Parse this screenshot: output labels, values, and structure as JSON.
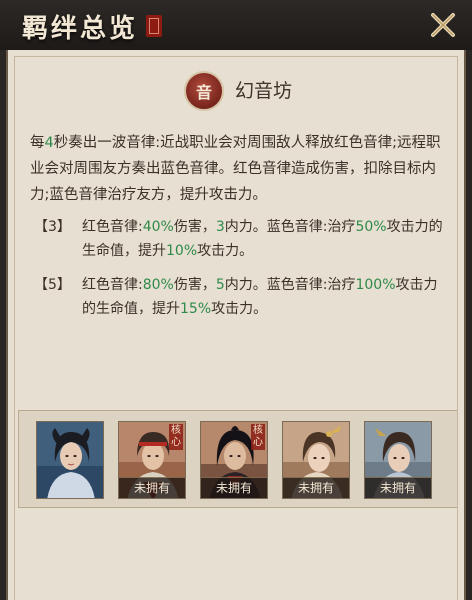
{
  "header": {
    "title": "羁绊总览"
  },
  "faction": {
    "badge_text": "音",
    "name": "幻音坊",
    "description_parts": [
      "每",
      "4",
      "秒奏出一波音律:近战职业会对周围敌人释放红色音律;远程职业会对周围友方奏出蓝色音律。红色音律造成伤害，扣除目标内力;蓝色音律治疗友方，提升攻击力。"
    ]
  },
  "tiers": [
    {
      "label": "【3】",
      "parts": [
        "红色音律:",
        "40%",
        "伤害，",
        "3",
        "内力。蓝色音律:治疗",
        "50%",
        "攻击力的生命值，提升",
        "10%",
        "攻击力。"
      ]
    },
    {
      "label": "【5】",
      "parts": [
        "红色音律:",
        "80%",
        "伤害，",
        "5",
        "内力。蓝色音律:治疗",
        "100%",
        "攻击力的生命值，提升",
        "15%",
        "攻击力。"
      ]
    }
  ],
  "heroes": [
    {
      "status": "",
      "core": "",
      "portrait": "female-dark-hair-icon"
    },
    {
      "status": "未拥有",
      "core": "核心",
      "portrait": "male-red-band-icon"
    },
    {
      "status": "未拥有",
      "core": "核心",
      "portrait": "male-black-hair-icon"
    },
    {
      "status": "未拥有",
      "core": "",
      "portrait": "female-gold-hairpin-icon"
    },
    {
      "status": "未拥有",
      "core": "",
      "portrait": "female-blue-robe-icon"
    }
  ],
  "colors": {
    "highlight": "#2f8a49",
    "body_text": "#3b3128",
    "parchment": "#e7dfd2",
    "header_bg": "#2a2623",
    "badge_red": "#8e2a1e"
  }
}
